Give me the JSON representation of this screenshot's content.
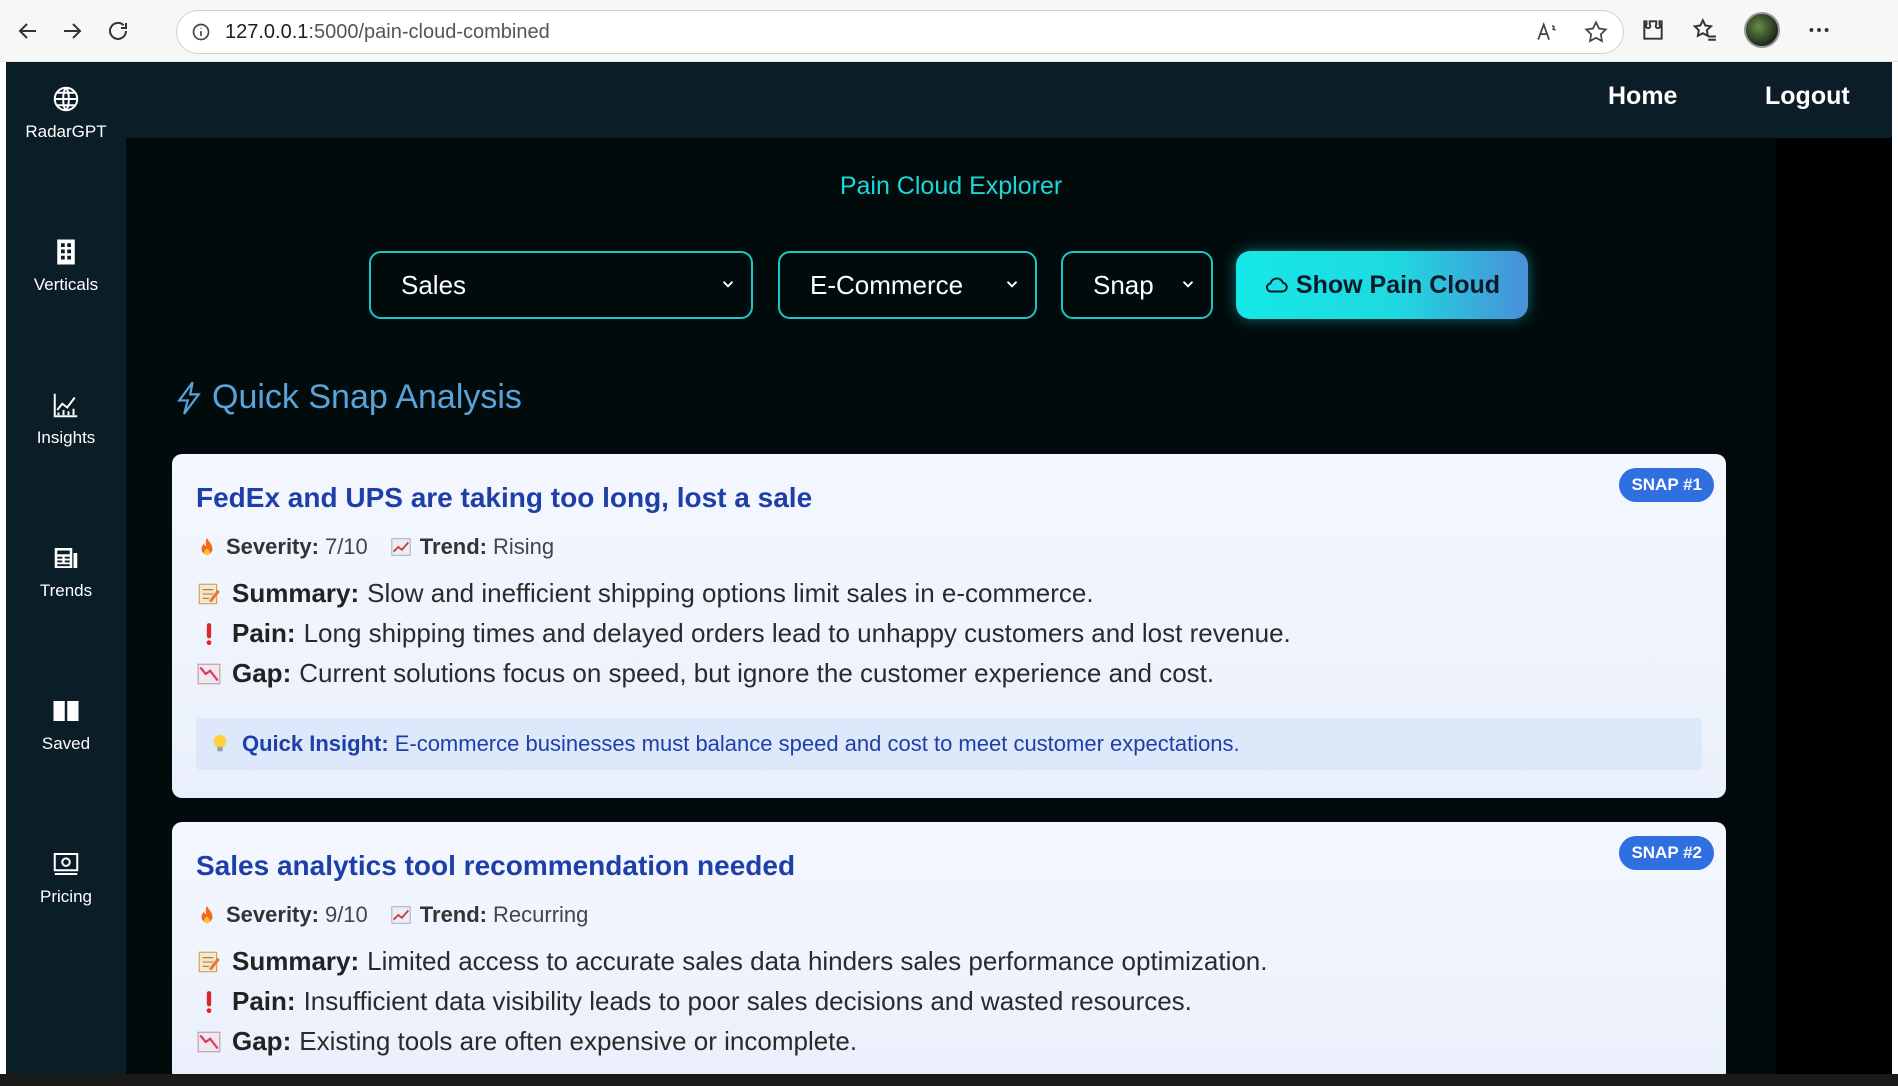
{
  "browser": {
    "url_host": "127.0.0.1",
    "url_path": ":5000/pain-cloud-combined",
    "icons": [
      "back-icon",
      "forward-icon",
      "reload-icon",
      "site-info-icon",
      "read-aloud-icon",
      "favorite-star-icon",
      "extensions-icon",
      "favorites-icon",
      "profile-avatar",
      "more-icon"
    ]
  },
  "sidebar": {
    "items": [
      {
        "label": "RadarGPT",
        "icon": "globe-icon"
      },
      {
        "label": "Verticals",
        "icon": "building-icon"
      },
      {
        "label": "Insights",
        "icon": "chart-icon"
      },
      {
        "label": "Trends",
        "icon": "newspaper-icon"
      },
      {
        "label": "Saved",
        "icon": "book-icon"
      },
      {
        "label": "Pricing",
        "icon": "cash-icon"
      }
    ]
  },
  "topbar": {
    "home": "Home",
    "logout": "Logout"
  },
  "page": {
    "title": "Pain Cloud Explorer",
    "filters": {
      "category": "Sales",
      "industry": "E-Commerce",
      "mode": "Snap"
    },
    "show_button": "Show Pain Cloud",
    "section_title": "Quick Snap Analysis"
  },
  "labels": {
    "severity": "Severity:",
    "trend": "Trend:",
    "summary": "Summary:",
    "pain": "Pain:",
    "gap": "Gap:",
    "quick_insight": "Quick Insight:"
  },
  "cards": [
    {
      "badge": "SNAP #1",
      "title": "FedEx and UPS are taking too long, lost a sale",
      "severity": "7/10",
      "trend": "Rising",
      "summary": "Slow and inefficient shipping options limit sales in e-commerce.",
      "pain": "Long shipping times and delayed orders lead to unhappy customers and lost revenue.",
      "gap": "Current solutions focus on speed, but ignore the customer experience and cost.",
      "insight": "E-commerce businesses must balance speed and cost to meet customer expectations."
    },
    {
      "badge": "SNAP #2",
      "title": "Sales analytics tool recommendation needed",
      "severity": "9/10",
      "trend": "Recurring",
      "summary": "Limited access to accurate sales data hinders sales performance optimization.",
      "pain": "Insufficient data visibility leads to poor sales decisions and wasted resources.",
      "gap": "Existing tools are often expensive or incomplete."
    }
  ],
  "colors": {
    "accent": "#19c9c9",
    "title_blue": "#1f3fa8",
    "badge_blue": "#2f6fe0",
    "sidebar": "#0b1d26"
  }
}
